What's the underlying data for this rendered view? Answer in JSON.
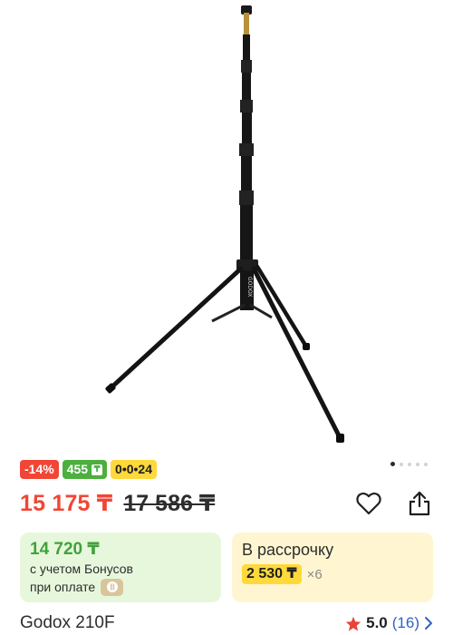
{
  "gallery": {
    "image_alt": "Godox 210F light stand",
    "stand_brand_label": "GODOX",
    "pager_total": 5,
    "pager_active": 1
  },
  "badges": {
    "discount": "-14%",
    "bonus": "455",
    "bonus_currency": "₸",
    "installment": "0•0•24"
  },
  "price": {
    "current": "15 175 ₸",
    "old": "17 586 ₸"
  },
  "bonus_card": {
    "price": "14 720 ₸",
    "line1": "с учетом Бонусов",
    "line2": "при оплате"
  },
  "installment_card": {
    "title": "В рассрочку",
    "monthly": "2 530 ₸",
    "times": "×6"
  },
  "product": {
    "title": "Godox 210F"
  },
  "rating": {
    "value": "5.0",
    "count": "(16)"
  },
  "icons": {
    "favorite": "heart-icon",
    "share": "share-icon",
    "star": "star-icon",
    "chevron": "chevron-right-icon",
    "payment": "kaspi-icon"
  },
  "colors": {
    "discount_red": "#f14635",
    "bonus_green": "#4caf3e",
    "installment_yellow": "#ffd93b",
    "link_blue": "#2f63c2"
  }
}
